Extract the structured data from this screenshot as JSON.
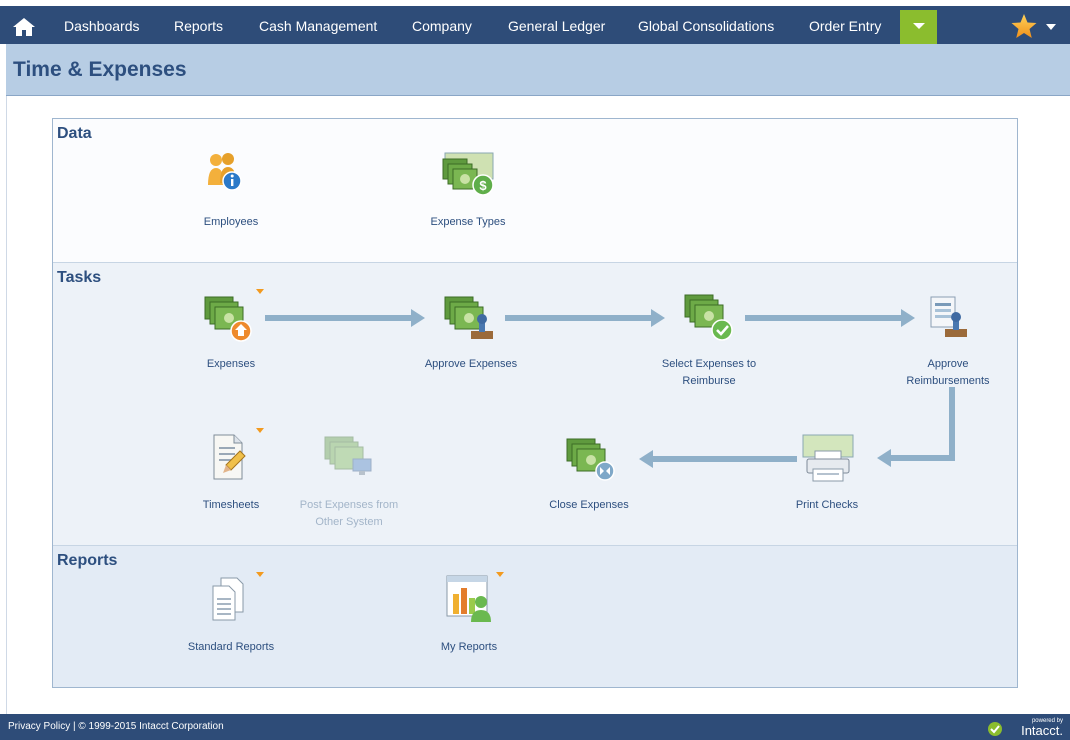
{
  "nav": {
    "items": [
      "Dashboards",
      "Reports",
      "Cash Management",
      "Company",
      "General Ledger",
      "Global Consolidations",
      "Order Entry"
    ]
  },
  "page": {
    "title": "Time & Expenses"
  },
  "sections": {
    "data": {
      "title": "Data",
      "employees": "Employees",
      "expense_types": "Expense Types"
    },
    "tasks": {
      "title": "Tasks",
      "expenses": "Expenses",
      "approve_expenses": "Approve Expenses",
      "select_expenses_1": "Select Expenses to",
      "select_expenses_2": "Reimburse",
      "approve_reimb_1": "Approve",
      "approve_reimb_2": "Reimbursements",
      "timesheets": "Timesheets",
      "post_expenses_1": "Post Expenses from",
      "post_expenses_2": "Other System",
      "close_expenses": "Close Expenses",
      "print_checks": "Print Checks"
    },
    "reports": {
      "title": "Reports",
      "standard_reports": "Standard Reports",
      "my_reports": "My Reports"
    }
  },
  "footer": {
    "copyright": "Privacy Policy | © 1999-2015  Intacct Corporation",
    "powered_by": "powered by",
    "brand": "Intacct."
  },
  "colors": {
    "nav_bg": "#2e4c78",
    "accent_green": "#8bbd2e",
    "title_bar": "#b7cde4",
    "link_text": "#2d4f7f",
    "caret_orange": "#f29a1f"
  }
}
